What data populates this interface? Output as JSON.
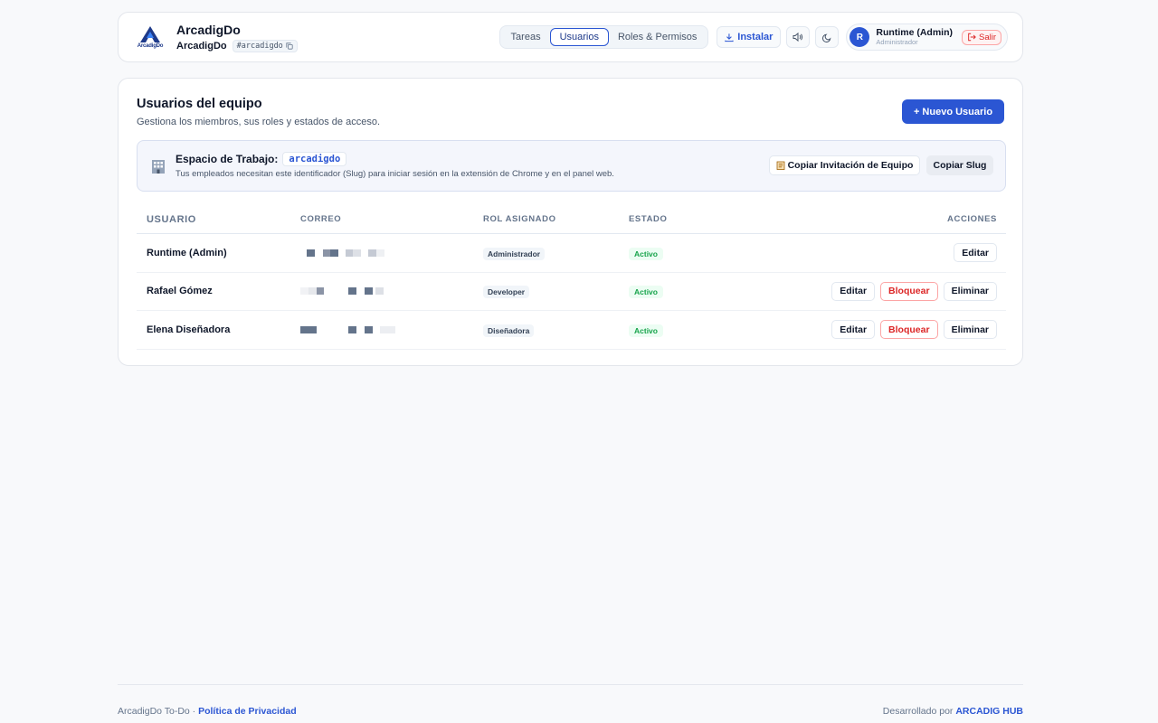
{
  "header": {
    "logo_word": "ArcadigDo",
    "title": "ArcadigDo",
    "subtitle": "ArcadigDo",
    "slug": "#arcadigdo",
    "nav": [
      {
        "label": "Tareas",
        "active": false
      },
      {
        "label": "Usuarios",
        "active": true
      },
      {
        "label": "Roles & Permisos",
        "active": false
      }
    ],
    "install_label": "Instalar",
    "user": {
      "initial": "R",
      "name": "Runtime (Admin)",
      "role": "Administrador",
      "logout_label": "Salir"
    }
  },
  "main": {
    "title": "Usuarios del equipo",
    "description": "Gestiona los miembros, sus roles y estados de acceso.",
    "new_user_label": "+ Nuevo Usuario",
    "workspace": {
      "label": "Espacio de Trabajo:",
      "slug": "arcadigdo",
      "description": "Tus empleados necesitan este identificador (Slug) para iniciar sesión en la extensión de Chrome y en el panel web.",
      "invite_label": "Copiar Invitación de Equipo",
      "copy_slug_label": "Copiar Slug"
    },
    "table": {
      "headers": [
        "USUARIO",
        "CORREO",
        "ROL ASIGNADO",
        "ESTADO",
        "ACCIONES"
      ],
      "rows": [
        {
          "user": "Runtime (Admin)",
          "role": "Administrador",
          "state": "Activo",
          "actions": [
            "Editar"
          ]
        },
        {
          "user": "Rafael Gómez",
          "role": "Developer",
          "state": "Activo",
          "actions": [
            "Editar",
            "Bloquear",
            "Eliminar"
          ]
        },
        {
          "user": "Elena Diseñadora",
          "role": "Diseñadora",
          "state": "Activo",
          "actions": [
            "Editar",
            "Bloquear",
            "Eliminar"
          ]
        }
      ]
    }
  },
  "footer": {
    "left_text": "ArcadigDo To-Do · ",
    "privacy_link": "Política de Privacidad",
    "right_text": "Desarrollado por ",
    "hub_link": "ARCADIG HUB"
  },
  "colors": {
    "accent": "#2b56d3",
    "danger": "#dc2626",
    "success": "#16a34a"
  }
}
